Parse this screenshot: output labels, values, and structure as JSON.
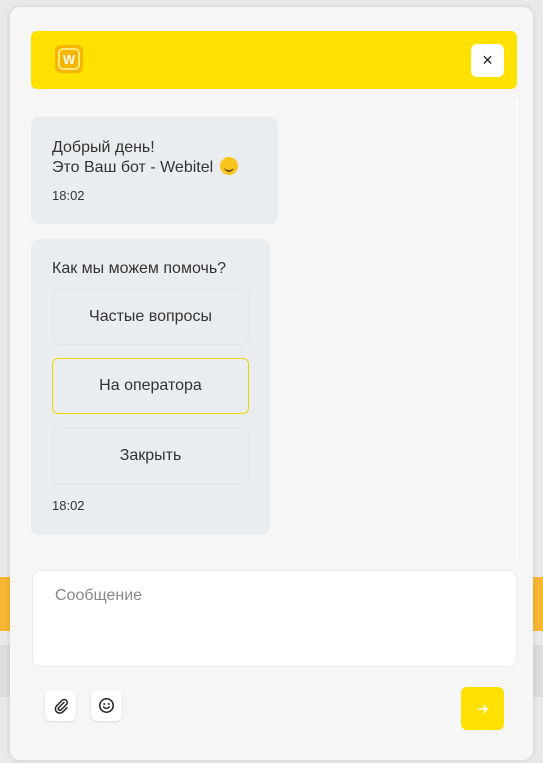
{
  "header": {
    "logo_letter": "W",
    "close_label": "×"
  },
  "messages": [
    {
      "lines": [
        "Добрый день!",
        "Это Ваш бот - Webitel"
      ],
      "time": "18:02"
    },
    {
      "question": "Как мы можем помочь?",
      "options": [
        "Частые вопросы",
        "На оператора",
        "Закрыть"
      ],
      "time": "18:02"
    }
  ],
  "composer": {
    "placeholder": "Сообщение"
  },
  "colors": {
    "accent": "#ffe100",
    "bubble": "#eaedf0"
  },
  "icons": [
    "close-icon",
    "paperclip-icon",
    "smiley-icon",
    "arrow-right-icon"
  ]
}
